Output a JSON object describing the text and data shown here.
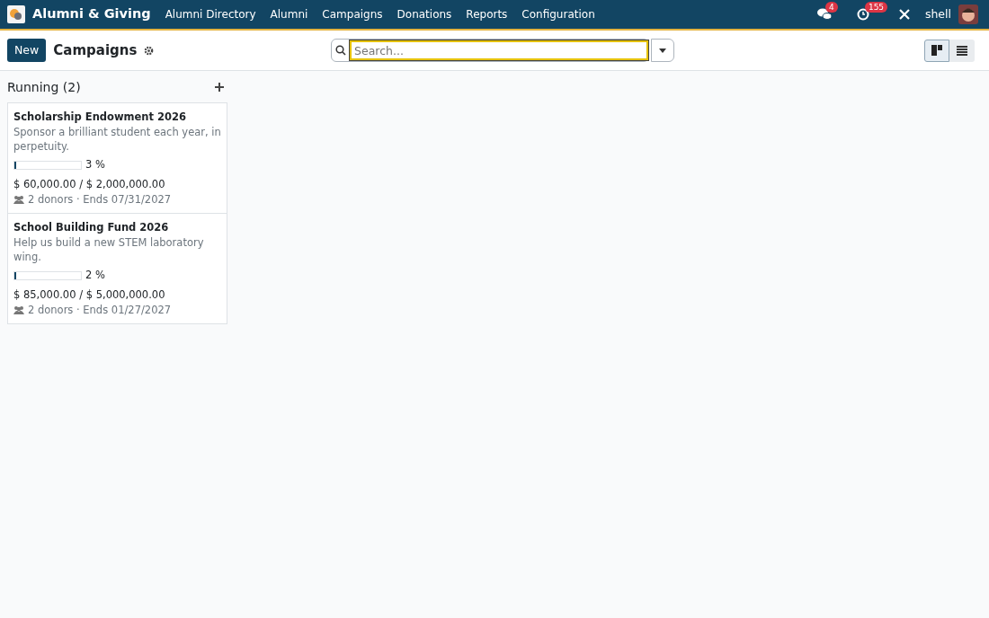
{
  "navbar": {
    "app_title": "Alumni & Giving",
    "menu": [
      "Alumni Directory",
      "Alumni",
      "Campaigns",
      "Donations",
      "Reports",
      "Configuration"
    ],
    "systray": {
      "messages_count": "4",
      "activities_count": "155",
      "user": "shell"
    }
  },
  "control_panel": {
    "new_button": "New",
    "breadcrumb": "Campaigns",
    "search": {
      "placeholder": "Search..."
    },
    "views": [
      {
        "kind": "kanban",
        "selected": true
      },
      {
        "kind": "list",
        "selected": false
      }
    ]
  },
  "columns": [
    {
      "title": "Running (2)",
      "cards": [
        {
          "title": "Scholarship Endowment 2026",
          "description": "Sponsor a brilliant student each year, in perpetuity.",
          "level": 0.03,
          "percent": "3 %",
          "amount": "$ 60,000.00 / $ 2,000,000.00",
          "meta": "2 donors · Ends 07/31/2027"
        },
        {
          "title": "School Building Fund 2026",
          "description": "Help us build a new STEM laboratory wing.",
          "level": 0.02,
          "percent": "2 %",
          "amount": "$ 85,000.00 / $ 5,000,000.00",
          "meta": "2 donors · Ends 01/27/2027"
        }
      ]
    }
  ]
}
